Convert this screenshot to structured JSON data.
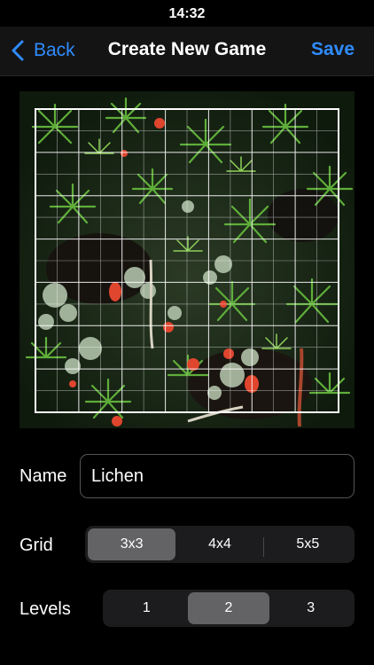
{
  "status_bar": {
    "time": "14:32"
  },
  "nav": {
    "back_label": "Back",
    "title": "Create New Game",
    "save_label": "Save"
  },
  "photo": {
    "icon": "moss-and-lichen-photo",
    "grid_overlay": "7x7"
  },
  "form": {
    "name_label": "Name",
    "name_value": "Lichen",
    "grid_label": "Grid",
    "grid_options": [
      "3x3",
      "4x4",
      "5x5"
    ],
    "grid_selected": "3x3",
    "levels_label": "Levels",
    "level_options": [
      "1",
      "2",
      "3"
    ],
    "level_selected": "2"
  },
  "colors": {
    "accent": "#2f8cff",
    "selected_segment": "#636366",
    "segment_bg": "#1c1c1e"
  }
}
